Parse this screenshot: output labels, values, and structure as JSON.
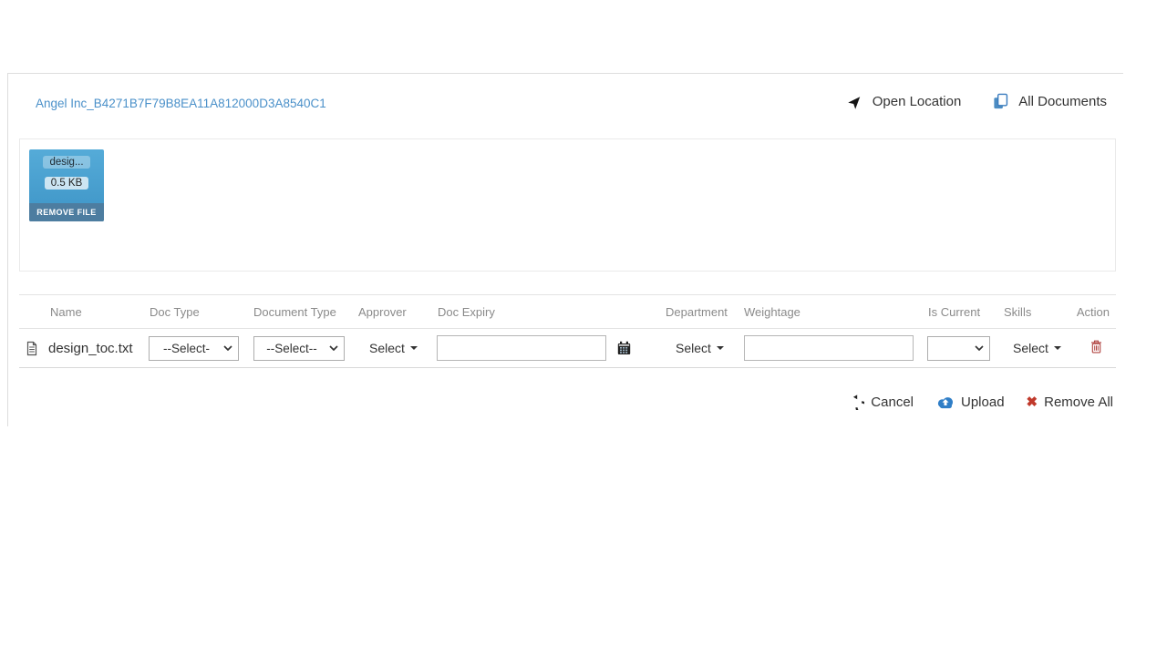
{
  "header": {
    "file_link": "Angel Inc_B4271B7F79B8EA11A812000D3A8540C1",
    "open_location_label": "Open Location",
    "all_documents_label": "All Documents"
  },
  "file_card": {
    "name_truncated": "desig...",
    "size": "0.5 KB",
    "remove_label": "REMOVE FILE"
  },
  "table": {
    "columns": [
      "Name",
      "Doc Type",
      "Document Type",
      "Approver",
      "Doc Expiry",
      "Department",
      "Weightage",
      "Is Current",
      "Skills",
      "Action"
    ],
    "row": {
      "name": "design_toc.txt",
      "doc_type_value": "--Select-",
      "document_type_value": "--Select--",
      "approver_label": "Select",
      "doc_expiry_value": "",
      "department_label": "Select",
      "weightage_value": "",
      "is_current_value": "",
      "skills_label": "Select"
    }
  },
  "footer": {
    "cancel_label": "Cancel",
    "upload_label": "Upload",
    "remove_all_label": "Remove All"
  },
  "icons": {
    "remove_all": "✖"
  },
  "colors": {
    "link": "#4a90c9",
    "card_top": "#55abd8",
    "card_bottom": "#3d94c6",
    "card_footer_bar": "#4d7da0",
    "all_documents_icon": "#3a7cbf",
    "upload_cloud": "#2f7ec7",
    "remove_x": "#c0392b",
    "trash": "#b04341",
    "header_text": "#8a8a8a"
  }
}
